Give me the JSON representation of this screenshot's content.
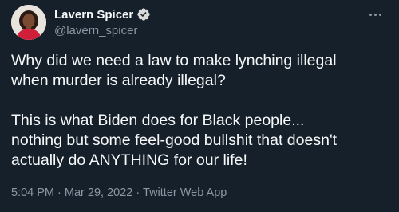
{
  "tweet": {
    "author": {
      "display_name": "Lavern Spicer",
      "handle": "@lavern_spicer",
      "verified": true
    },
    "icons": {
      "more": "more-options-icon",
      "verified": "verified-badge-icon"
    },
    "text": {
      "line1": "Why did we need a law to make lynching illegal",
      "line2": "when murder is already illegal?",
      "line3": "This is what Biden does for Black people...",
      "line4": "nothing but some feel-good bullshit that doesn't",
      "line5": "actually do ANYTHING for our life!"
    },
    "meta": {
      "time": "5:04 PM",
      "date": "Mar 29, 2022",
      "source": "Twitter Web App",
      "separator": "·"
    }
  },
  "colors": {
    "background": "#15202b",
    "text": "#f7f9f9",
    "secondary": "#8b98a5",
    "verified": "#1d9bf0"
  }
}
